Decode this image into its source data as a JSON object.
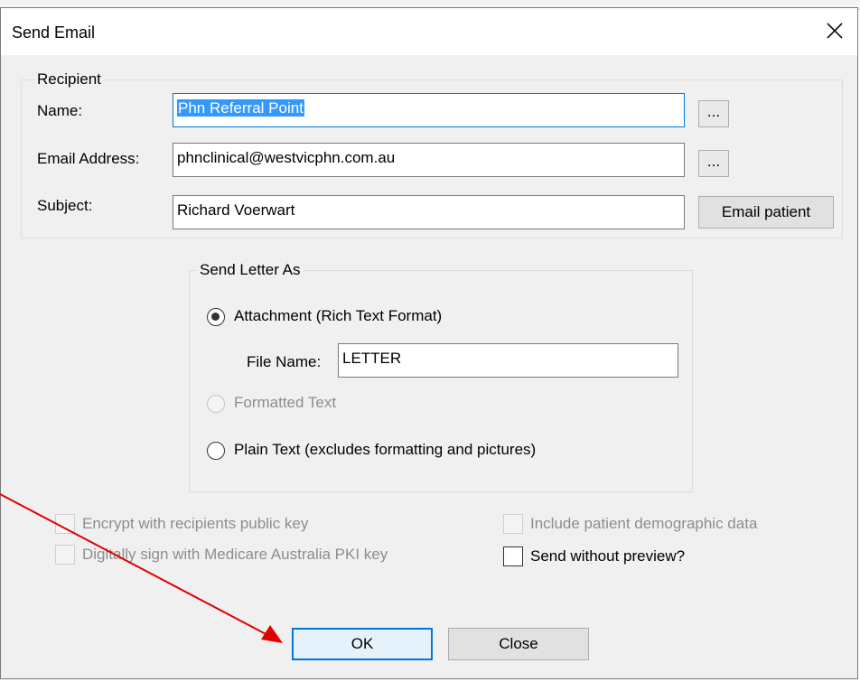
{
  "window": {
    "title": "Send Email"
  },
  "recipient": {
    "group_label": "Recipient",
    "name_label": "Name:",
    "name_value": "Phn Referral Point",
    "email_label": "Email Address:",
    "email_value": "phnclinical@westvicphn.com.au",
    "subject_label": "Subject:",
    "subject_value": "Richard Voerwart",
    "browse_label": "...",
    "email_patient_label": "Email patient"
  },
  "send_as": {
    "group_label": "Send Letter As",
    "options": [
      {
        "label": "Attachment (Rich Text Format)",
        "selected": true,
        "enabled": true
      },
      {
        "label": "Formatted Text",
        "selected": false,
        "enabled": false
      },
      {
        "label": "Plain Text (excludes formatting and pictures)",
        "selected": false,
        "enabled": true
      }
    ],
    "file_name_label": "File Name:",
    "file_name_value": "LETTER"
  },
  "options": {
    "encrypt_label": "Encrypt with recipients public key",
    "sign_label": "Digitally sign with Medicare Australia PKI key",
    "demographic_label": "Include patient demographic data",
    "no_preview_label": "Send without preview?"
  },
  "buttons": {
    "ok": "OK",
    "close": "Close"
  },
  "colors": {
    "annotation_arrow": "#e00000",
    "focus_border": "#0078d7",
    "selection": "#3399ff"
  }
}
